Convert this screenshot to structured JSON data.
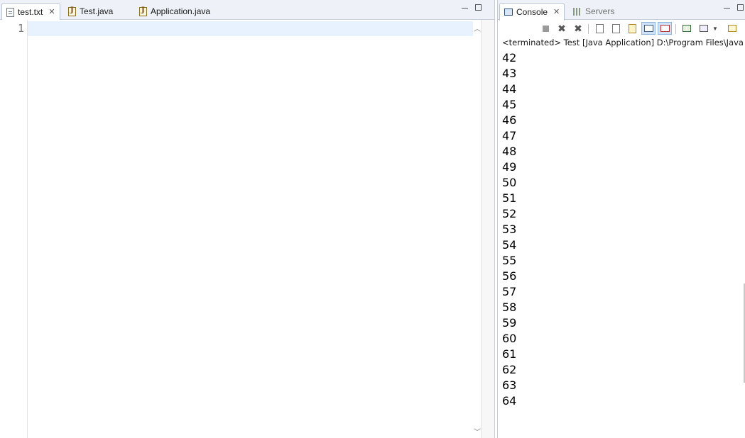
{
  "editor": {
    "tabs": [
      {
        "label": "test.txt",
        "icon": "text-file-icon",
        "active": true,
        "closable": true
      },
      {
        "label": "Test.java",
        "icon": "java-file-icon",
        "active": false
      },
      {
        "label": "Application.java",
        "icon": "java-file-icon",
        "active": false
      }
    ],
    "line_number": "1"
  },
  "console": {
    "tabs": [
      {
        "label": "Console",
        "icon": "console-icon",
        "active": true,
        "closable": true
      },
      {
        "label": "Servers",
        "icon": "servers-icon",
        "active": false
      }
    ],
    "status": "<terminated> Test [Java Application] D:\\Program Files\\Java",
    "output": [
      "42",
      "43",
      "44",
      "45",
      "46",
      "47",
      "48",
      "49",
      "50",
      "51",
      "52",
      "53",
      "54",
      "55",
      "56",
      "57",
      "58",
      "59",
      "60",
      "61",
      "62",
      "63",
      "64"
    ]
  },
  "colors": {
    "current_line": "#e8f2fe",
    "tab_bar": "#eef2f8",
    "pressed_button": "#cfe3f8"
  }
}
